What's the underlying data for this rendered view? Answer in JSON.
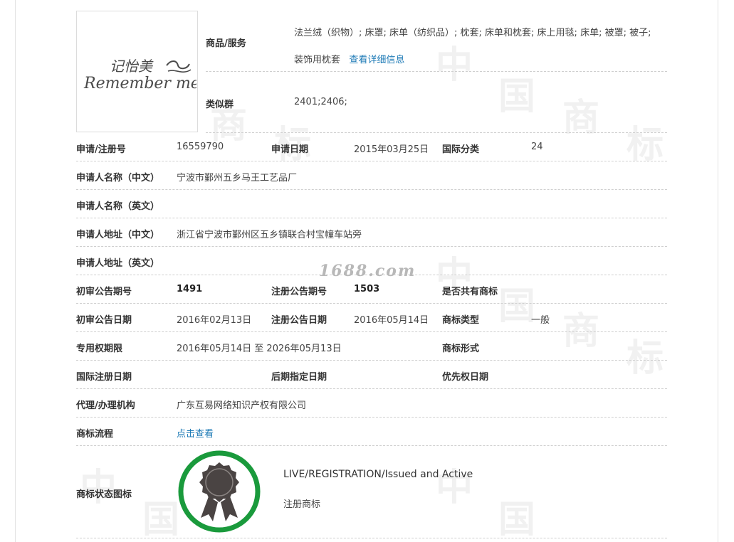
{
  "logo": {
    "chinese": "记怡美",
    "english": "Remember me",
    "swirl": "~"
  },
  "watermark": {
    "site": "1688.com",
    "chars": [
      "中",
      "国",
      "商",
      "标"
    ]
  },
  "top": {
    "goods_label": "商品/服务",
    "goods_value": "法兰绒（织物）; 床罩; 床单（纺织品）; 枕套; 床单和枕套; 床上用毯; 床单; 被罩; 被子; 装饰用枕套",
    "goods_link": "查看详细信息",
    "similar_label": "类似群",
    "similar_value": "2401;2406;"
  },
  "rows": {
    "reg": {
      "l1": "申请/注册号",
      "v1": "16559790",
      "l2": "申请日期",
      "v2": "2015年03月25日",
      "l3": "国际分类",
      "v3": "24"
    },
    "applicant_cn": {
      "label": "申请人名称（中文）",
      "value": "宁波市鄞州五乡马王工艺品厂"
    },
    "applicant_en": {
      "label": "申请人名称（英文）",
      "value": ""
    },
    "address_cn": {
      "label": "申请人地址（中文）",
      "value": "浙江省宁波市鄞州区五乡镇联合村宝幢车站旁"
    },
    "address_en": {
      "label": "申请人地址（英文）",
      "value": ""
    },
    "announce_no": {
      "l1": "初审公告期号",
      "v1": "1491",
      "l2": "注册公告期号",
      "v2": "1503",
      "l3": "是否共有商标",
      "v3": ""
    },
    "announce_date": {
      "l1": "初审公告日期",
      "v1": "2016年02月13日",
      "l2": "注册公告日期",
      "v2": "2016年05月14日",
      "l3": "商标类型",
      "v3": "一般"
    },
    "validity": {
      "l1": "专用权期限",
      "v1": "2016年05月14日 至 2026年05月13日",
      "l3": "商标形式",
      "v3": ""
    },
    "intl": {
      "l1": "国际注册日期",
      "v1": "",
      "l2": "后期指定日期",
      "v2": "",
      "l3": "优先权日期",
      "v3": ""
    },
    "agent": {
      "label": "代理/办理机构",
      "value": "广东互易网络知识产权有限公司"
    },
    "flow": {
      "label": "商标流程",
      "link": "点击查看"
    }
  },
  "status": {
    "label": "商标状态图标",
    "en": "LIVE/REGISTRATION/Issued and Active",
    "cn": "注册商标",
    "ring_color": "#1a9a3c",
    "medal_color": "#4a4443"
  }
}
